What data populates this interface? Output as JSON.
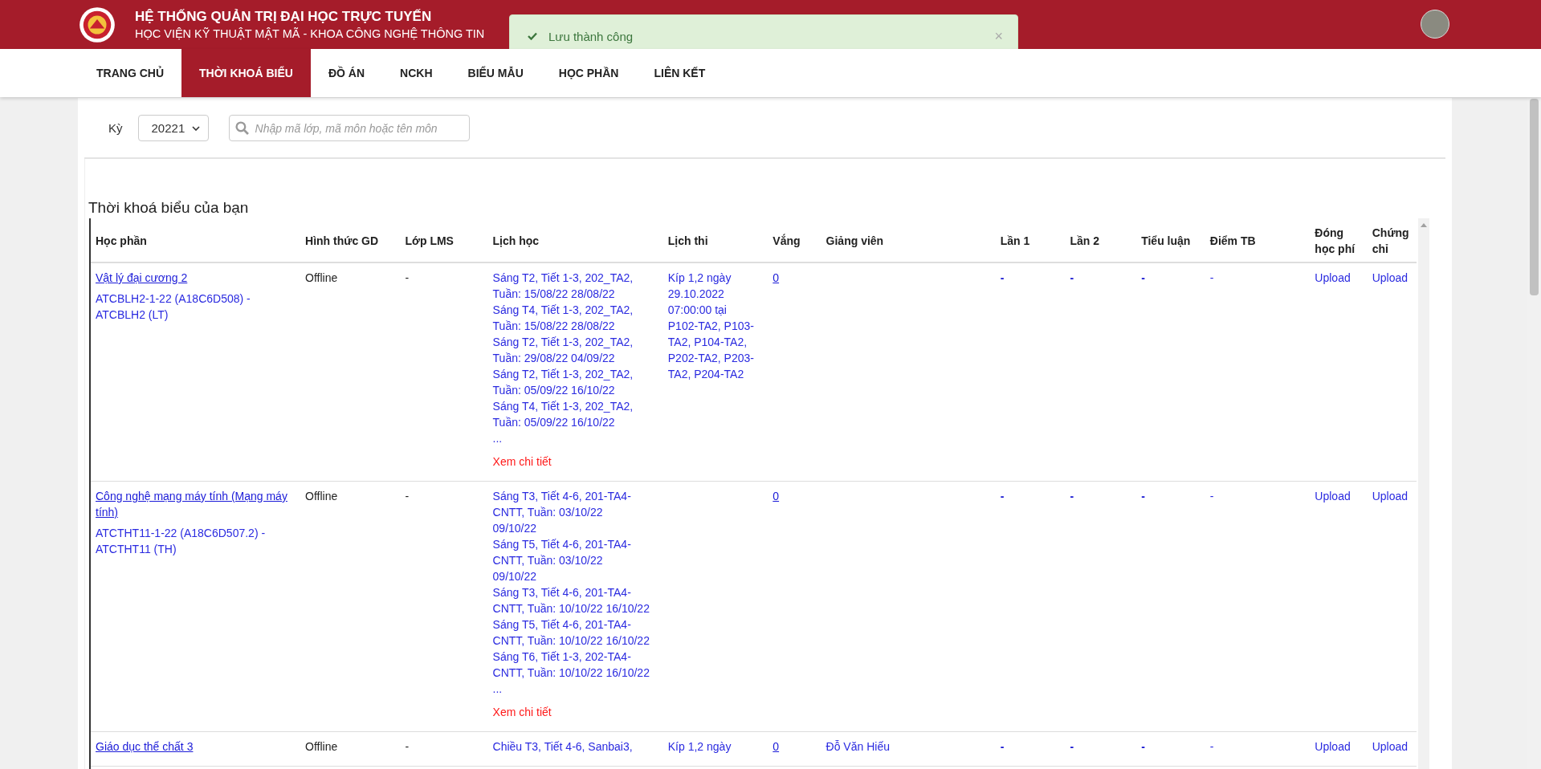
{
  "header": {
    "title": "HỆ THỐNG QUẢN TRỊ ĐẠI HỌC TRỰC TUYẾN",
    "subtitle": "HỌC VIỆN KỸ THUẬT MẬT MÃ - KHOA CÔNG NGHỆ THÔNG TIN"
  },
  "toast": {
    "message": "Lưu thành công",
    "close": "×"
  },
  "nav": [
    {
      "label": "TRANG CHỦ",
      "selected": false
    },
    {
      "label": "THỜI KHOÁ BIỂU",
      "selected": true
    },
    {
      "label": "ĐỒ ÁN",
      "selected": false
    },
    {
      "label": "NCKH",
      "selected": false
    },
    {
      "label": "BIỂU MẪU",
      "selected": false
    },
    {
      "label": "HỌC PHẦN",
      "selected": false
    },
    {
      "label": "LIÊN KẾT",
      "selected": false
    }
  ],
  "filter": {
    "term_label": "Kỳ",
    "term_value": "20221",
    "search_placeholder": "Nhập mã lớp, mã môn hoặc tên môn"
  },
  "section_title": "Thời khoá biểu của bạn",
  "table": {
    "columns": [
      "Học phần",
      "Hình thức GD",
      "Lớp LMS",
      "Lịch học",
      "Lịch thi",
      "Vắng",
      "Giảng viên",
      "Lần 1",
      "Lần 2",
      "Tiểu luận",
      "Điểm TB",
      "Đóng học phí",
      "Chứng chỉ"
    ],
    "rows": [
      {
        "course": "Vật lý đại cương 2",
        "class_code": "ATCBLH2-1-22 (A18C6D508) - ATCBLH2 (LT)",
        "mode": "Offline",
        "lms": "-",
        "schedule": [
          "Sáng T2, Tiết 1-3, 202_TA2,",
          "Tuần: 15/08/22 28/08/22",
          "Sáng T4, Tiết 1-3, 202_TA2,",
          "Tuần: 15/08/22 28/08/22",
          "Sáng T2, Tiết 1-3, 202_TA2,",
          "Tuần: 29/08/22 04/09/22",
          "Sáng T2, Tiết 1-3, 202_TA2,",
          "Tuần: 05/09/22 16/10/22",
          "Sáng T4, Tiết 1-3, 202_TA2,",
          "Tuần: 05/09/22 16/10/22"
        ],
        "schedule_more": "...",
        "detail": "Xem chi tiết",
        "exam": [
          "Kíp 1,2 ngày",
          "29.10.2022",
          "07:00:00 tại",
          "P102-TA2, P103-",
          "TA2, P104-TA2,",
          "P202-TA2, P203-",
          "TA2, P204-TA2"
        ],
        "absent": "0",
        "lecturer": "",
        "score1": "-",
        "score2": "-",
        "essay": "-",
        "average": "-",
        "fee": "Upload",
        "certificate": "Upload"
      },
      {
        "course": "Công nghệ mạng máy tính (Mạng máy tính)",
        "class_code": "ATCTHT11-1-22 (A18C6D507.2) - ATCTHT11 (TH)",
        "mode": "Offline",
        "lms": "-",
        "schedule": [
          "Sáng T3, Tiết 4-6, 201-TA4-",
          "CNTT, Tuần: 03/10/22",
          "09/10/22",
          "Sáng T5, Tiết 4-6, 201-TA4-",
          "CNTT, Tuần: 03/10/22",
          "09/10/22",
          "Sáng T3, Tiết 4-6, 201-TA4-",
          "CNTT, Tuần: 10/10/22 16/10/22",
          "Sáng T5, Tiết 4-6, 201-TA4-",
          "CNTT, Tuần: 10/10/22 16/10/22",
          "Sáng T6, Tiết 1-3, 202-TA4-",
          "CNTT, Tuần: 10/10/22 16/10/22"
        ],
        "schedule_more": "...",
        "detail": "Xem chi tiết",
        "exam": [],
        "absent": "0",
        "lecturer": "",
        "score1": "-",
        "score2": "-",
        "essay": "-",
        "average": "-",
        "fee": "Upload",
        "certificate": "Upload"
      },
      {
        "course": "Giáo dục thể chất 3",
        "mode": "Offline",
        "lms": "-",
        "schedule": [
          "Chiều T3, Tiết 4-6, Sanbai3,"
        ],
        "exam": [
          "Kíp 1,2 ngày"
        ],
        "absent": "0",
        "lecturer": "Đỗ Văn Hiếu",
        "score1": "-",
        "score2": "-",
        "essay": "-",
        "average": "-",
        "fee": "Upload",
        "certificate": "Upload"
      }
    ]
  }
}
